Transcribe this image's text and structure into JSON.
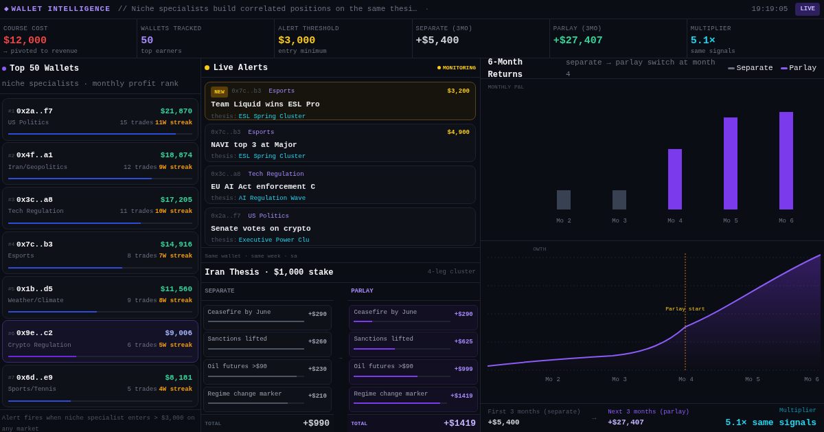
{
  "header": {
    "logo_mark": "◆",
    "title": "WALLET INTELLIGENCE",
    "tagline": "// Niche specialists build correlated positions on the same thesi…",
    "dot": "·",
    "time": "19:19:05",
    "status": "LIVE"
  },
  "stats": [
    {
      "label": "COURSE COST",
      "value": "$12,000",
      "note": "→ pivoted to revenue",
      "color": "#ef4444"
    },
    {
      "label": "WALLETS TRACKED",
      "value": "50",
      "note": "top earners",
      "color": "#a78bfa"
    },
    {
      "label": "ALERT THRESHOLD",
      "value": "$3,000",
      "note": "entry minimum",
      "color": "#facc15"
    },
    {
      "label": "SEPARATE (3MO)",
      "value": "+$5,400",
      "color": "#d1d5db"
    },
    {
      "label": "PARLAY (3MO)",
      "value": "+$27,407",
      "color": "#34d399"
    },
    {
      "label": "MULTIPLIER",
      "value": "5.1×",
      "note": "same signals",
      "color": "#22d3ee"
    }
  ],
  "wallets_panel": {
    "title": "Top 50 Wallets",
    "subtitle": "niche specialists · monthly profit rank",
    "wallets": [
      {
        "rank": "#1",
        "address": "0x2a..f7",
        "profit": "$21,870",
        "category": "US Politics",
        "trades": "15 trades",
        "streak": "11W streak",
        "level": 0.91,
        "selected": false
      },
      {
        "rank": "#2",
        "address": "0x4f..a1",
        "profit": "$18,874",
        "category": "Iran/Geopolitics",
        "trades": "12 trades",
        "streak": "9W streak",
        "level": 0.78,
        "selected": false
      },
      {
        "rank": "#3",
        "address": "0x3c..a8",
        "profit": "$17,205",
        "category": "Tech Regulation",
        "trades": "11 trades",
        "streak": "10W streak",
        "level": 0.72,
        "selected": false
      },
      {
        "rank": "#4",
        "address": "0x7c..b3",
        "profit": "$14,916",
        "category": "Esports",
        "trades": "8 trades",
        "streak": "7W streak",
        "level": 0.62,
        "selected": false
      },
      {
        "rank": "#5",
        "address": "0x1b..d5",
        "profit": "$11,560",
        "category": "Weather/Climate",
        "trades": "9 trades",
        "streak": "8W streak",
        "level": 0.48,
        "selected": false
      },
      {
        "rank": "#6",
        "address": "0x9e..c2",
        "profit": "$9,006",
        "category": "Crypto Regulation",
        "trades": "6 trades",
        "streak": "5W streak",
        "level": 0.37,
        "selected": true
      },
      {
        "rank": "#7",
        "address": "0x6d..e9",
        "profit": "$8,181",
        "category": "Sports/Tennis",
        "trades": "5 trades",
        "streak": "4W streak",
        "level": 0.34,
        "selected": false
      }
    ],
    "footer": "Alert fires when niche specialist enters > $3,000 on any market"
  },
  "alerts_panel": {
    "title": "Live Alerts",
    "status": "MONITORING",
    "alerts": [
      {
        "badge": "NEW",
        "wallet": "0x7c..b3",
        "category": "Esports",
        "amount": "$3,200",
        "market": "Team Liquid wins ESL Pro",
        "thesis_label": "thesis:",
        "thesis": "ESL Spring Cluster"
      },
      {
        "wallet": "0x7c..b3",
        "category": "Esports",
        "amount": "$4,900",
        "market": "NAVI top 3 at Major",
        "thesis_label": "thesis:",
        "thesis": "ESL Spring Cluster"
      },
      {
        "wallet": "0x3c..a8",
        "category": "Tech Regulation",
        "market": "EU AI Act enforcement C",
        "thesis_label": "thesis:",
        "thesis": "AI Regulation Wave"
      },
      {
        "wallet": "0x2a..f7",
        "category": "US Politics",
        "market": "Senate votes on crypto",
        "thesis_label": "thesis:",
        "thesis": "Executive Power Clu"
      }
    ],
    "footer": "Same wallet · same week · sa"
  },
  "thesis_panel": {
    "title": "Iran Thesis · $1,000 stake",
    "note": "4-leg cluster",
    "arrow": "→",
    "columns": [
      {
        "kind": "separate",
        "title": "SEPARATE",
        "legs": [
          {
            "name": "Ceasefire by June",
            "gain": "+$290",
            "level": 1.0
          },
          {
            "name": "Sanctions lifted",
            "gain": "+$260",
            "level": 1.0
          },
          {
            "name": "Oil futures >$90",
            "gain": "+$230",
            "level": 0.92
          },
          {
            "name": "Regime change marker",
            "gain": "+$210",
            "level": 0.83
          }
        ],
        "total_label": "TOTAL",
        "total": "+$990"
      },
      {
        "kind": "parlay",
        "title": "PARLAY",
        "legs": [
          {
            "name": "Ceasefire by June",
            "gain": "+$290",
            "level": 0.19
          },
          {
            "name": "Sanctions lifted",
            "gain": "+$625",
            "level": 0.42
          },
          {
            "name": "Oil futures >$90",
            "gain": "+$999",
            "level": 0.66
          },
          {
            "name": "Regime change marker",
            "gain": "+$1419",
            "level": 0.93
          }
        ],
        "total_label": "TOTAL",
        "total": "+$1419"
      }
    ]
  },
  "returns_panel": {
    "title": "6-Month Returns",
    "subtitle": "separate → parlay switch at month 4",
    "legend": [
      {
        "label": "Separate",
        "color": "#6b7280"
      },
      {
        "label": "Parlay",
        "color": "#8b5cf6"
      }
    ],
    "monthly": {
      "label": "MONTHLY P&L",
      "bars": [
        {
          "label": "Mo 2",
          "kind": "separate"
        },
        {
          "label": "Mo 3",
          "kind": "separate"
        },
        {
          "label": "Mo 4",
          "kind": "parlay"
        },
        {
          "label": "Mo 5",
          "kind": "parlay"
        },
        {
          "label": "Mo 6",
          "kind": "parlay"
        }
      ]
    },
    "growth": {
      "label": "OWTH",
      "x_labels": [
        "Mo 2",
        "Mo 3",
        "Mo 4",
        "Mo 5",
        "Mo 6"
      ],
      "annotation": "Parlay start"
    },
    "summary": {
      "first_label": "First 3 months (separate)",
      "first_value": "+$5,400",
      "arrow": "→",
      "next_label": "Next 3 months (parlay)",
      "next_value": "+$27,407",
      "mult_label": "Multiplier",
      "mult_value": "5.1× same signals"
    }
  }
}
